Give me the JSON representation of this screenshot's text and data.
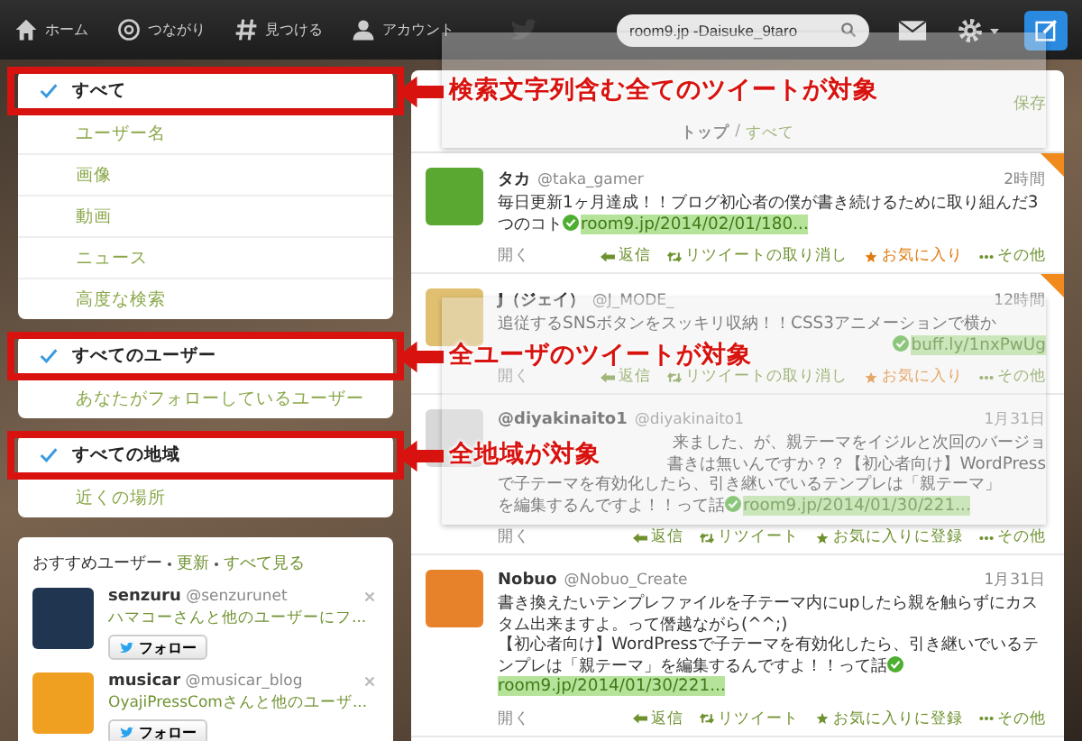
{
  "topbar": {
    "nav": [
      {
        "kind": "home",
        "label": "ホーム"
      },
      {
        "kind": "at",
        "label": "つながり"
      },
      {
        "kind": "hash",
        "label": "見つける"
      },
      {
        "kind": "person",
        "label": "アカウント"
      }
    ],
    "search": {
      "value": "room9.jp -Daisuke_9taro"
    }
  },
  "filters": [
    {
      "items": [
        {
          "label": "すべて",
          "selected": true
        },
        {
          "label": "ユーザー名",
          "selected": false
        },
        {
          "label": "画像",
          "selected": false
        },
        {
          "label": "動画",
          "selected": false
        },
        {
          "label": "ニュース",
          "selected": false
        },
        {
          "label": "高度な検索",
          "selected": false
        }
      ],
      "annotation": "検索文字列含む全てのツイートが対象"
    },
    {
      "items": [
        {
          "label": "すべてのユーザー",
          "selected": true
        },
        {
          "label": "あなたがフォローしているユーザー",
          "selected": false
        }
      ],
      "annotation": "全ユーザのツイートが対象"
    },
    {
      "items": [
        {
          "label": "すべての地域",
          "selected": true
        },
        {
          "label": "近くの場所",
          "selected": false
        }
      ],
      "annotation": "全地域が対象"
    }
  ],
  "suggestions": {
    "title": "おすすめユーザー",
    "refresh": "更新",
    "view_all": "すべて見る",
    "users": [
      {
        "name": "senzuru",
        "handle": "@senzurunet",
        "context": "ハマコーさんと他のユーザーにフ...",
        "follow": "フォロー",
        "color": "#1f3550"
      },
      {
        "name": "musicar",
        "handle": "@musicar_blog",
        "context": "OyajiPressComさんと他のユーザ...",
        "follow": "フォロー",
        "color": "#f0a020"
      }
    ]
  },
  "timeline": {
    "save": "保存",
    "tab_separator": "/",
    "tabs": [
      {
        "label": "トップ",
        "selected": false
      },
      {
        "label": "すべて",
        "selected": true
      }
    ],
    "tweets": [
      {
        "name": "タカ",
        "handle": "@taka_gamer",
        "time": "2時間",
        "lines": [
          {
            "text": "毎日更新1ヶ月達成！！ブログ初心者の僕が書き続けるために取り組んだ3つのコト"
          }
        ],
        "link_covered": false,
        "link": "room9.jp/2014/02/01/180...",
        "favorited": true,
        "color": "#5aa832",
        "actions": [
          {
            "kind": "open",
            "label": "開く"
          },
          {
            "kind": "reply",
            "label": "返信"
          },
          {
            "kind": "retweet",
            "label": "リツイートの取り消し"
          },
          {
            "kind": "favorite",
            "label": "お気に入り"
          },
          {
            "kind": "more",
            "label": "その他"
          }
        ]
      },
      {
        "name": "J（ジェイ）",
        "handle": "@J_MODE_",
        "time": "12時間",
        "lines": [
          {
            "text": "追従するSNSボタンをスッキリ収納！！CSS3アニメーションで横か",
            "covered": false
          }
        ],
        "link_covered": true,
        "link": "buff.ly/1nxPwUg",
        "favorited": true,
        "color": "#e0c070",
        "actions": [
          {
            "kind": "open",
            "label": "開く"
          },
          {
            "kind": "reply",
            "label": "返信"
          },
          {
            "kind": "retweet",
            "label": "リツイートの取り消し"
          },
          {
            "kind": "favorite",
            "label": "お気に入り"
          },
          {
            "kind": "more",
            "label": "その他"
          }
        ]
      },
      {
        "name": "@diyakinaito1",
        "handle": "@diyakinaito1",
        "time": "1月31日",
        "lines": [
          {
            "text": "来ました、が、親テーマをイジルと次回のバージョ",
            "covered": true
          },
          {
            "text": "書きは無いんですか？？【初心者向け】WordPress",
            "covered": true
          },
          {
            "text": "で子テーマを有効化したら、引き継いでいるテンプレは「親テーマ」",
            "covered": false
          },
          {
            "text": "を編集するんですよ！！って話",
            "covered": false
          }
        ],
        "link_covered": false,
        "link": "room9.jp/2014/01/30/221...",
        "favorited": false,
        "color": "#d8d8d8",
        "actions": [
          {
            "kind": "open",
            "label": "開く"
          },
          {
            "kind": "reply",
            "label": "返信"
          },
          {
            "kind": "retweet",
            "label": "リツイート"
          },
          {
            "kind": "favorite",
            "label": "お気に入りに登録"
          },
          {
            "kind": "more",
            "label": "その他"
          }
        ]
      },
      {
        "name": "Nobuo",
        "handle": "@Nobuo_Create",
        "time": "1月31日",
        "lines": [
          {
            "text": "書き換えたいテンプレファイルを子テーマ内にupしたら親を触らずにカスタム出来ますよ。って僭越ながら(^^;)"
          },
          {
            "text": "【初心者向け】WordPressで子テーマを有効化したら、引き継いでいるテンプレは「親テーマ」を編集するんですよ！！って話"
          }
        ],
        "link_covered": false,
        "link": "room9.jp/2014/01/30/221...",
        "favorited": false,
        "color": "#e8822a",
        "actions": [
          {
            "kind": "open",
            "label": "開く"
          },
          {
            "kind": "reply",
            "label": "返信"
          },
          {
            "kind": "retweet",
            "label": "リツイート"
          },
          {
            "kind": "favorite",
            "label": "お気に入りに登録"
          },
          {
            "kind": "more",
            "label": "その他"
          }
        ]
      }
    ]
  }
}
